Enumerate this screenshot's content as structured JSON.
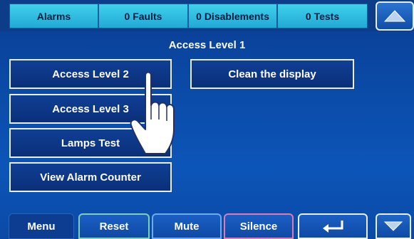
{
  "status_tabs": {
    "alarms": "Alarms",
    "faults": "0 Faults",
    "disablements": "0 Disablements",
    "tests": "0 Tests"
  },
  "page_title": "Access Level 1",
  "menu": {
    "access_level_2": "Access Level 2",
    "access_level_3": "Access Level 3",
    "lamps_test": "Lamps Test",
    "view_alarm_counter": "View Alarm Counter",
    "clean_display": "Clean the display"
  },
  "bottom_bar": {
    "menu": "Menu",
    "reset": "Reset",
    "mute": "Mute",
    "silence": "Silence"
  },
  "icons": {
    "scroll_up": "triangle-up-icon",
    "scroll_down": "triangle-down-icon",
    "return": "return-arrow-icon",
    "pointer": "hand-pointer-icon"
  },
  "colors": {
    "background": "#0a4aa6",
    "tab": "#2bb6df",
    "button": "#0a2f78"
  }
}
